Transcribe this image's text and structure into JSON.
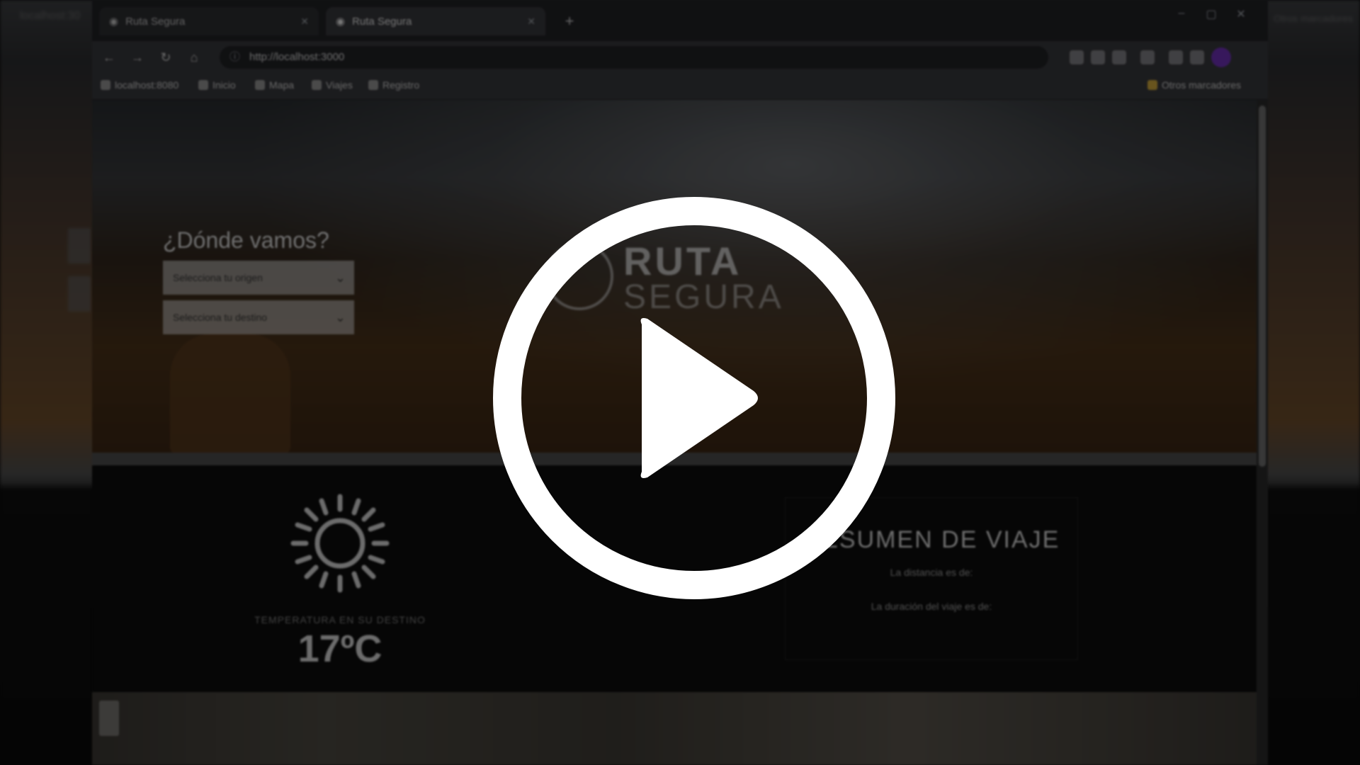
{
  "background_window": {
    "left_label": "localhost:30",
    "right_label": "Otros marcadores"
  },
  "browser": {
    "tabs": [
      {
        "title": "Ruta Segura",
        "active": false
      },
      {
        "title": "Ruta Segura",
        "active": true
      }
    ],
    "new_tab_symbol": "+",
    "omnibox_url": "http://localhost:3000",
    "bookmarks": [
      {
        "label": "localhost:8080"
      },
      {
        "label": "Inicio"
      },
      {
        "label": "Mapa"
      },
      {
        "label": "Viajes"
      },
      {
        "label": "Registro"
      }
    ],
    "other_bookmarks": "Otros marcadores"
  },
  "page": {
    "form_title": "¿Dónde vamos?",
    "origin_select_placeholder": "Selecciona tu origen",
    "destination_select_placeholder": "Selecciona tu destino",
    "logo_line1": "RUTA",
    "logo_line2": "SEGURA",
    "weather_label": "TEMPERATURA EN SU DESTINO",
    "temperature": "17ºC",
    "summary_title": "RESUMEN DE VIAJE",
    "summary_distance": "La distancia es de:",
    "summary_duration": "La duración del viaje es de:"
  },
  "icons": {
    "play": "play-icon",
    "sun": "sun-icon"
  },
  "colors": {
    "overlay": "#000000",
    "play_button": "#ffffff",
    "profile_avatar": "#6a2fb0"
  }
}
